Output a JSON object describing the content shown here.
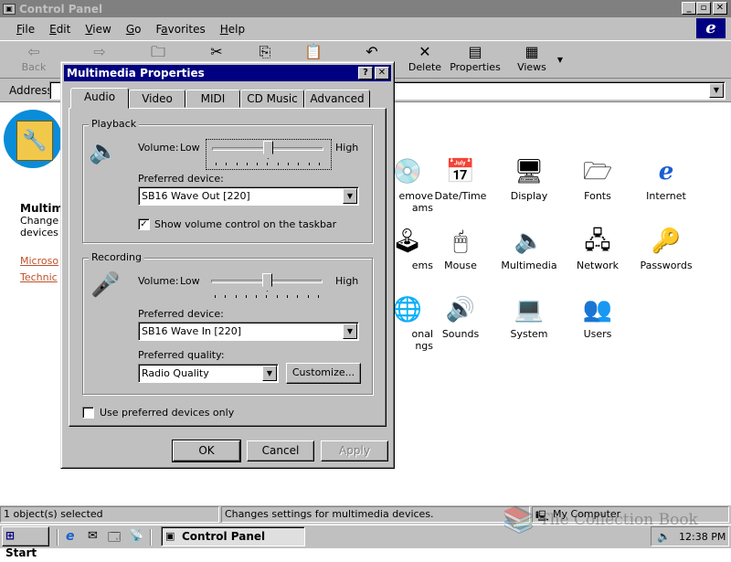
{
  "window": {
    "title": "Control Panel",
    "min": "_",
    "max": "▫",
    "close": "✕"
  },
  "menu": [
    "File",
    "Edit",
    "View",
    "Go",
    "Favorites",
    "Help"
  ],
  "menu_underline": [
    "F",
    "E",
    "V",
    "G",
    "a",
    "H"
  ],
  "toolbar": {
    "back": "Back",
    "forward": "Forward",
    "up": "Up",
    "cut": "Cut",
    "copy": "Copy",
    "paste": "Paste",
    "undo": "Undo",
    "delete": "Delete",
    "properties": "Properties",
    "views": "Views"
  },
  "address": {
    "label": "Address"
  },
  "leftpane": {
    "title": "Multim",
    "desc_line1": "Change",
    "desc_line2": "devices",
    "link1": "Microso",
    "link2": "Technic"
  },
  "icons": [
    {
      "label": "Add/Remove Programs",
      "l1": "emove",
      "l2": "ams"
    },
    {
      "label": "Date/Time"
    },
    {
      "label": "Display"
    },
    {
      "label": "Fonts"
    },
    {
      "label": "Internet"
    },
    {
      "label": "Game Controllers",
      "l1": "ems"
    },
    {
      "label": "Mouse"
    },
    {
      "label": "Multimedia"
    },
    {
      "label": "Network"
    },
    {
      "label": "Passwords"
    },
    {
      "label": "Regional Settings",
      "l1": "onal",
      "l2": "ngs"
    },
    {
      "label": "Sounds"
    },
    {
      "label": "System"
    },
    {
      "label": "Users"
    }
  ],
  "status": {
    "count": "1 object(s) selected",
    "desc": "Changes settings for multimedia devices.",
    "zone": "My Computer"
  },
  "taskbar": {
    "start": "Start",
    "task": "Control Panel",
    "clock": "12:38 PM"
  },
  "dialog": {
    "title": "Multimedia Properties",
    "help": "?",
    "close": "✕",
    "tabs": [
      "Audio",
      "Video",
      "MIDI",
      "CD Music",
      "Advanced"
    ],
    "active_tab": "Audio",
    "playback": {
      "legend": "Playback",
      "volume": "Volume:",
      "low": "Low",
      "high": "High",
      "volume_level": 0.5,
      "preferred_device_label": "Preferred device:",
      "device": "SB16 Wave Out [220]",
      "show_volume": "Show volume control on the taskbar",
      "show_volume_checked": true
    },
    "recording": {
      "legend": "Recording",
      "volume": "Volume:",
      "low": "Low",
      "high": "High",
      "volume_level": 0.5,
      "preferred_device_label": "Preferred device:",
      "device": "SB16 Wave In [220]",
      "quality_label": "Preferred quality:",
      "quality": "Radio Quality",
      "customize": "Customize..."
    },
    "use_preferred": "Use preferred devices only",
    "use_preferred_checked": false,
    "ok": "OK",
    "cancel": "Cancel",
    "apply": "Apply"
  },
  "watermark": "The Collection Book"
}
